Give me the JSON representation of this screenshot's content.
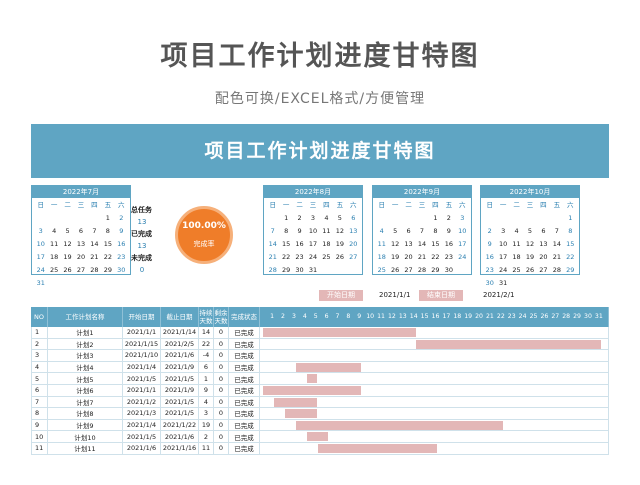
{
  "header": {
    "title": "项目工作计划进度甘特图",
    "subtitle": "配色可换/EXCEL格式/方便管理"
  },
  "banner": {
    "title": "项目工作计划进度甘特图"
  },
  "calendars": [
    {
      "month": "2022年7月",
      "days": [
        "日",
        "一",
        "二",
        "三",
        "四",
        "五",
        "六"
      ],
      "cells": [
        "",
        "",
        "",
        "",
        "",
        "1",
        "2",
        "3",
        "4",
        "5",
        "6",
        "7",
        "8",
        "9",
        "10",
        "11",
        "12",
        "13",
        "14",
        "15",
        "16",
        "17",
        "18",
        "19",
        "20",
        "21",
        "22",
        "23",
        "24",
        "25",
        "26",
        "27",
        "28",
        "29",
        "30",
        "31",
        "",
        "",
        "",
        "",
        "",
        ""
      ]
    },
    {
      "month": "2022年8月",
      "days": [
        "日",
        "一",
        "二",
        "三",
        "四",
        "五",
        "六"
      ],
      "cells": [
        "",
        "1",
        "2",
        "3",
        "4",
        "5",
        "6",
        "7",
        "8",
        "9",
        "10",
        "11",
        "12",
        "13",
        "14",
        "15",
        "16",
        "17",
        "18",
        "19",
        "20",
        "21",
        "22",
        "23",
        "24",
        "25",
        "26",
        "27",
        "28",
        "29",
        "30",
        "31",
        "",
        "",
        ""
      ]
    },
    {
      "month": "2022年9月",
      "days": [
        "日",
        "一",
        "二",
        "三",
        "四",
        "五",
        "六"
      ],
      "cells": [
        "",
        "",
        "",
        "",
        "1",
        "2",
        "3",
        "4",
        "5",
        "6",
        "7",
        "8",
        "9",
        "10",
        "11",
        "12",
        "13",
        "14",
        "15",
        "16",
        "17",
        "18",
        "19",
        "20",
        "21",
        "22",
        "23",
        "24",
        "25",
        "26",
        "27",
        "28",
        "29",
        "30",
        ""
      ]
    },
    {
      "month": "2022年10月",
      "days": [
        "日",
        "一",
        "二",
        "三",
        "四",
        "五",
        "六"
      ],
      "cells": [
        "",
        "",
        "",
        "",
        "",
        "",
        "1",
        "2",
        "3",
        "4",
        "5",
        "6",
        "7",
        "8",
        "9",
        "10",
        "11",
        "12",
        "13",
        "14",
        "15",
        "16",
        "17",
        "18",
        "19",
        "20",
        "21",
        "22",
        "23",
        "24",
        "25",
        "26",
        "27",
        "28",
        "29",
        "30",
        "31",
        "",
        "",
        "",
        "",
        ""
      ]
    }
  ],
  "stats": {
    "total_label": "总任务",
    "total_value": "13",
    "done_label": "已完成",
    "done_value": "13",
    "undone_label": "未完成",
    "undone_value": "0"
  },
  "progress": {
    "percent_text": "100.00%",
    "label": "完成率",
    "color": "#ef7d29"
  },
  "legend": {
    "start_label": "开始日期",
    "start_value": "2021/1/1",
    "end_label": "结束日期",
    "end_value": "2021/2/1"
  },
  "table": {
    "headers": {
      "no": "NO",
      "name": "工作计划名称",
      "start": "开始日期",
      "end": "截止日期",
      "duration": "持续天数",
      "remaining": "剩余天数",
      "status": "完成状态"
    },
    "timeline": [
      "1",
      "2",
      "3",
      "4",
      "5",
      "6",
      "7",
      "8",
      "9",
      "10",
      "11",
      "12",
      "13",
      "14",
      "15",
      "16",
      "17",
      "18",
      "19",
      "20",
      "21",
      "22",
      "23",
      "24",
      "25",
      "26",
      "27",
      "28",
      "29",
      "30",
      "31"
    ],
    "rows": [
      {
        "no": "1",
        "name": "计划1",
        "start": "2021/1/1",
        "end": "2021/1/14",
        "duration": "14",
        "remaining": "0",
        "status": "已完成",
        "bar_start": 1,
        "bar_end": 14
      },
      {
        "no": "2",
        "name": "计划2",
        "start": "2021/1/15",
        "end": "2021/2/5",
        "duration": "22",
        "remaining": "0",
        "status": "已完成",
        "bar_start": 15,
        "bar_end": 31
      },
      {
        "no": "3",
        "name": "计划3",
        "start": "2021/1/10",
        "end": "2021/1/6",
        "duration": "-4",
        "remaining": "0",
        "status": "已完成",
        "bar_start": 0,
        "bar_end": 0
      },
      {
        "no": "4",
        "name": "计划4",
        "start": "2021/1/4",
        "end": "2021/1/9",
        "duration": "6",
        "remaining": "0",
        "status": "已完成",
        "bar_start": 4,
        "bar_end": 9
      },
      {
        "no": "5",
        "name": "计划5",
        "start": "2021/1/5",
        "end": "2021/1/5",
        "duration": "1",
        "remaining": "0",
        "status": "已完成",
        "bar_start": 5,
        "bar_end": 5
      },
      {
        "no": "6",
        "name": "计划6",
        "start": "2021/1/1",
        "end": "2021/1/9",
        "duration": "9",
        "remaining": "0",
        "status": "已完成",
        "bar_start": 1,
        "bar_end": 9
      },
      {
        "no": "7",
        "name": "计划7",
        "start": "2021/1/2",
        "end": "2021/1/5",
        "duration": "4",
        "remaining": "0",
        "status": "已完成",
        "bar_start": 2,
        "bar_end": 5
      },
      {
        "no": "8",
        "name": "计划8",
        "start": "2021/1/3",
        "end": "2021/1/5",
        "duration": "3",
        "remaining": "0",
        "status": "已完成",
        "bar_start": 3,
        "bar_end": 5
      },
      {
        "no": "9",
        "name": "计划9",
        "start": "2021/1/4",
        "end": "2021/1/22",
        "duration": "19",
        "remaining": "0",
        "status": "已完成",
        "bar_start": 4,
        "bar_end": 22
      },
      {
        "no": "10",
        "name": "计划10",
        "start": "2021/1/5",
        "end": "2021/1/6",
        "duration": "2",
        "remaining": "0",
        "status": "已完成",
        "bar_start": 5,
        "bar_end": 6
      },
      {
        "no": "11",
        "name": "计划11",
        "start": "2021/1/6",
        "end": "2021/1/16",
        "duration": "11",
        "remaining": "0",
        "status": "已完成",
        "bar_start": 6,
        "bar_end": 16
      }
    ]
  }
}
